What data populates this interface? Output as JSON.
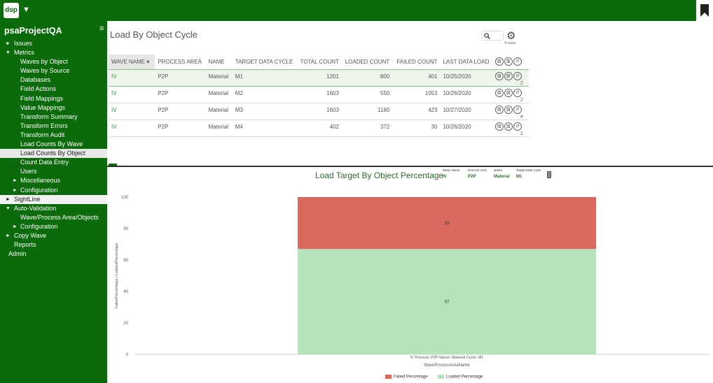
{
  "app": {
    "logo": "dsp",
    "project": "psaProjectQA"
  },
  "sidebar": {
    "items": [
      {
        "label": "Issues",
        "level": 0,
        "arrow": "►"
      },
      {
        "label": "Metrics",
        "level": 0,
        "arrow": "▼"
      },
      {
        "label": "Waves by Object",
        "level": 1
      },
      {
        "label": "Waves by Source",
        "level": 1
      },
      {
        "label": "Databases",
        "level": 1
      },
      {
        "label": "Field Actions",
        "level": 1
      },
      {
        "label": "Field Mappings",
        "level": 1
      },
      {
        "label": "Value Mappings",
        "level": 1
      },
      {
        "label": "Transform Summary",
        "level": 1
      },
      {
        "label": "Transform Errors",
        "level": 1
      },
      {
        "label": "Transform Audit",
        "level": 1
      },
      {
        "label": "Load Counts By Wave",
        "level": 1
      },
      {
        "label": "Load Counts By Object",
        "level": 1,
        "active": true
      },
      {
        "label": "Count Data Entry",
        "level": 1
      },
      {
        "label": "Users",
        "level": 1
      },
      {
        "label": "Miscellaneous",
        "level": 1,
        "arrow": "►"
      },
      {
        "label": "Configuration",
        "level": 1,
        "arrow": "►"
      },
      {
        "label": "SightLine",
        "level": 0,
        "arrow": "►",
        "light": true
      },
      {
        "label": "Auto-Validation",
        "level": 0,
        "arrow": "▼"
      },
      {
        "label": "Wave/Process Area/Objects",
        "level": 1
      },
      {
        "label": "Configuration",
        "level": 1,
        "arrow": "►"
      },
      {
        "label": "Copy Wave",
        "level": 0,
        "arrow": "►"
      },
      {
        "label": "Reports",
        "level": 0
      },
      {
        "label": "Admin",
        "level": -1
      }
    ]
  },
  "page": {
    "title": "Load By Object Cycle",
    "rows_label": "4 rows"
  },
  "table": {
    "headers": [
      "WAVE NAME ▾",
      "PROCESS AREA",
      "NAME",
      "TARGET DATA CYCLE",
      "TOTAL COUNT",
      "LOADED COUNT",
      "FAILED COUNT",
      "LAST DATA LOAD"
    ],
    "rows": [
      {
        "wave": "IV",
        "area": "P2P",
        "name": "Material",
        "cycle": "M1",
        "total": "1201",
        "loaded": "800",
        "failed": "401",
        "last": "10/25/2020",
        "count": "2"
      },
      {
        "wave": "IV",
        "area": "P2P",
        "name": "Material",
        "cycle": "M2",
        "total": "1603",
        "loaded": "550",
        "failed": "1053",
        "last": "10/26/2020",
        "count": "2"
      },
      {
        "wave": "IV",
        "area": "P2P",
        "name": "Material",
        "cycle": "M3",
        "total": "1603",
        "loaded": "1180",
        "failed": "423",
        "last": "10/27/2020",
        "count": "4"
      },
      {
        "wave": "IV",
        "area": "P2P",
        "name": "Material",
        "cycle": "M4",
        "total": "402",
        "loaded": "372",
        "failed": "30",
        "last": "10/26/2020",
        "count": "1"
      }
    ]
  },
  "chart_title": "Load Target By Object Percentage",
  "filters": [
    {
      "label": "Wave Name",
      "value": "IV"
    },
    {
      "label": "Process Area",
      "value": "P2P"
    },
    {
      "label": "Name",
      "value": "Material"
    },
    {
      "label": "Target Data Cycle",
      "value": "M1"
    }
  ],
  "chart_data": {
    "type": "bar",
    "stacked": true,
    "categories": [
      "IV Process: P2P Name: Material Cycle: M1"
    ],
    "series": [
      {
        "name": "Loaded Percentage",
        "values": [
          67
        ],
        "color": "#b5e4bc"
      },
      {
        "name": "Failed Percentage",
        "values": [
          33
        ],
        "color": "#d9695f"
      }
    ],
    "xlabel": "WaveProcessAreaName",
    "ylabel": "FailedPercentage | LoadedPercentage",
    "yticks": [
      0,
      20,
      40,
      60,
      80,
      100
    ],
    "ylim": [
      0,
      100
    ],
    "legend": [
      "Failed Percentage",
      "Loaded Percentage"
    ],
    "legend_position": "bottom"
  }
}
